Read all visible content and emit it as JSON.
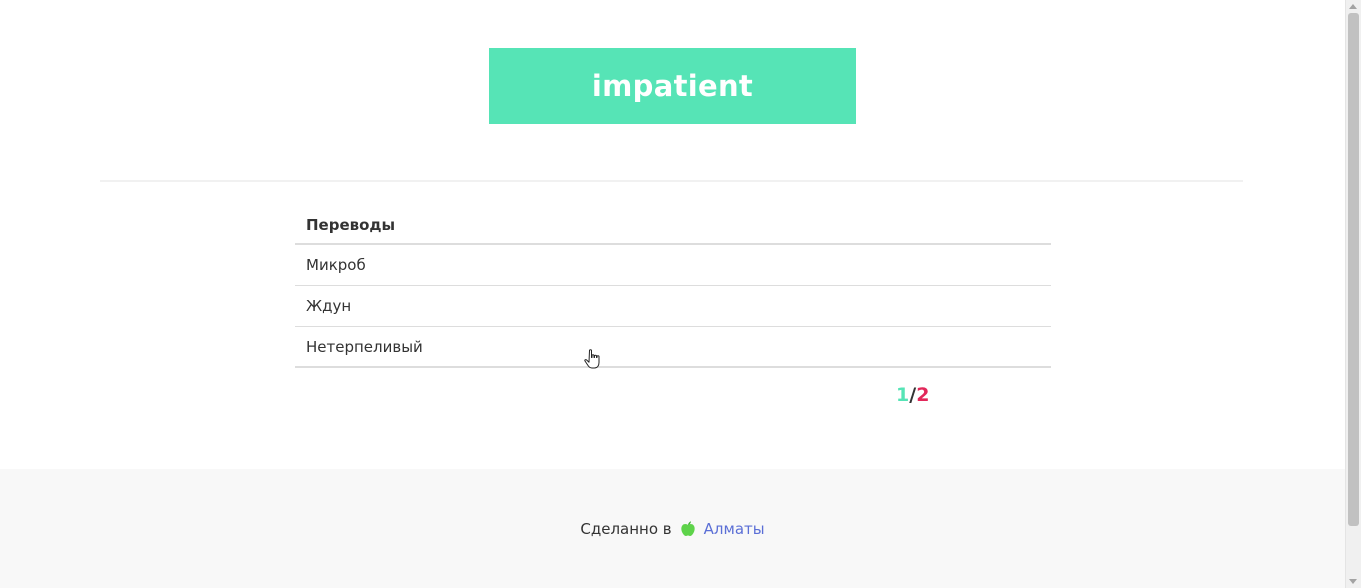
{
  "word": {
    "text": "impatient",
    "banner_color": "#56e4b6"
  },
  "translations": {
    "header": "Переводы",
    "rows": [
      "Микроб",
      "Ждун",
      "Нетерпеливый"
    ]
  },
  "pager": {
    "current": "1",
    "separator": "/",
    "total": "2",
    "current_color": "#56e4b6",
    "total_color": "#e2285a"
  },
  "footer": {
    "text": "Сделанно в",
    "icon": "apple-icon",
    "link_text": "Алматы",
    "link_color": "#5b6fd6"
  },
  "cursor": {
    "icon": "hand-pointer-icon"
  }
}
